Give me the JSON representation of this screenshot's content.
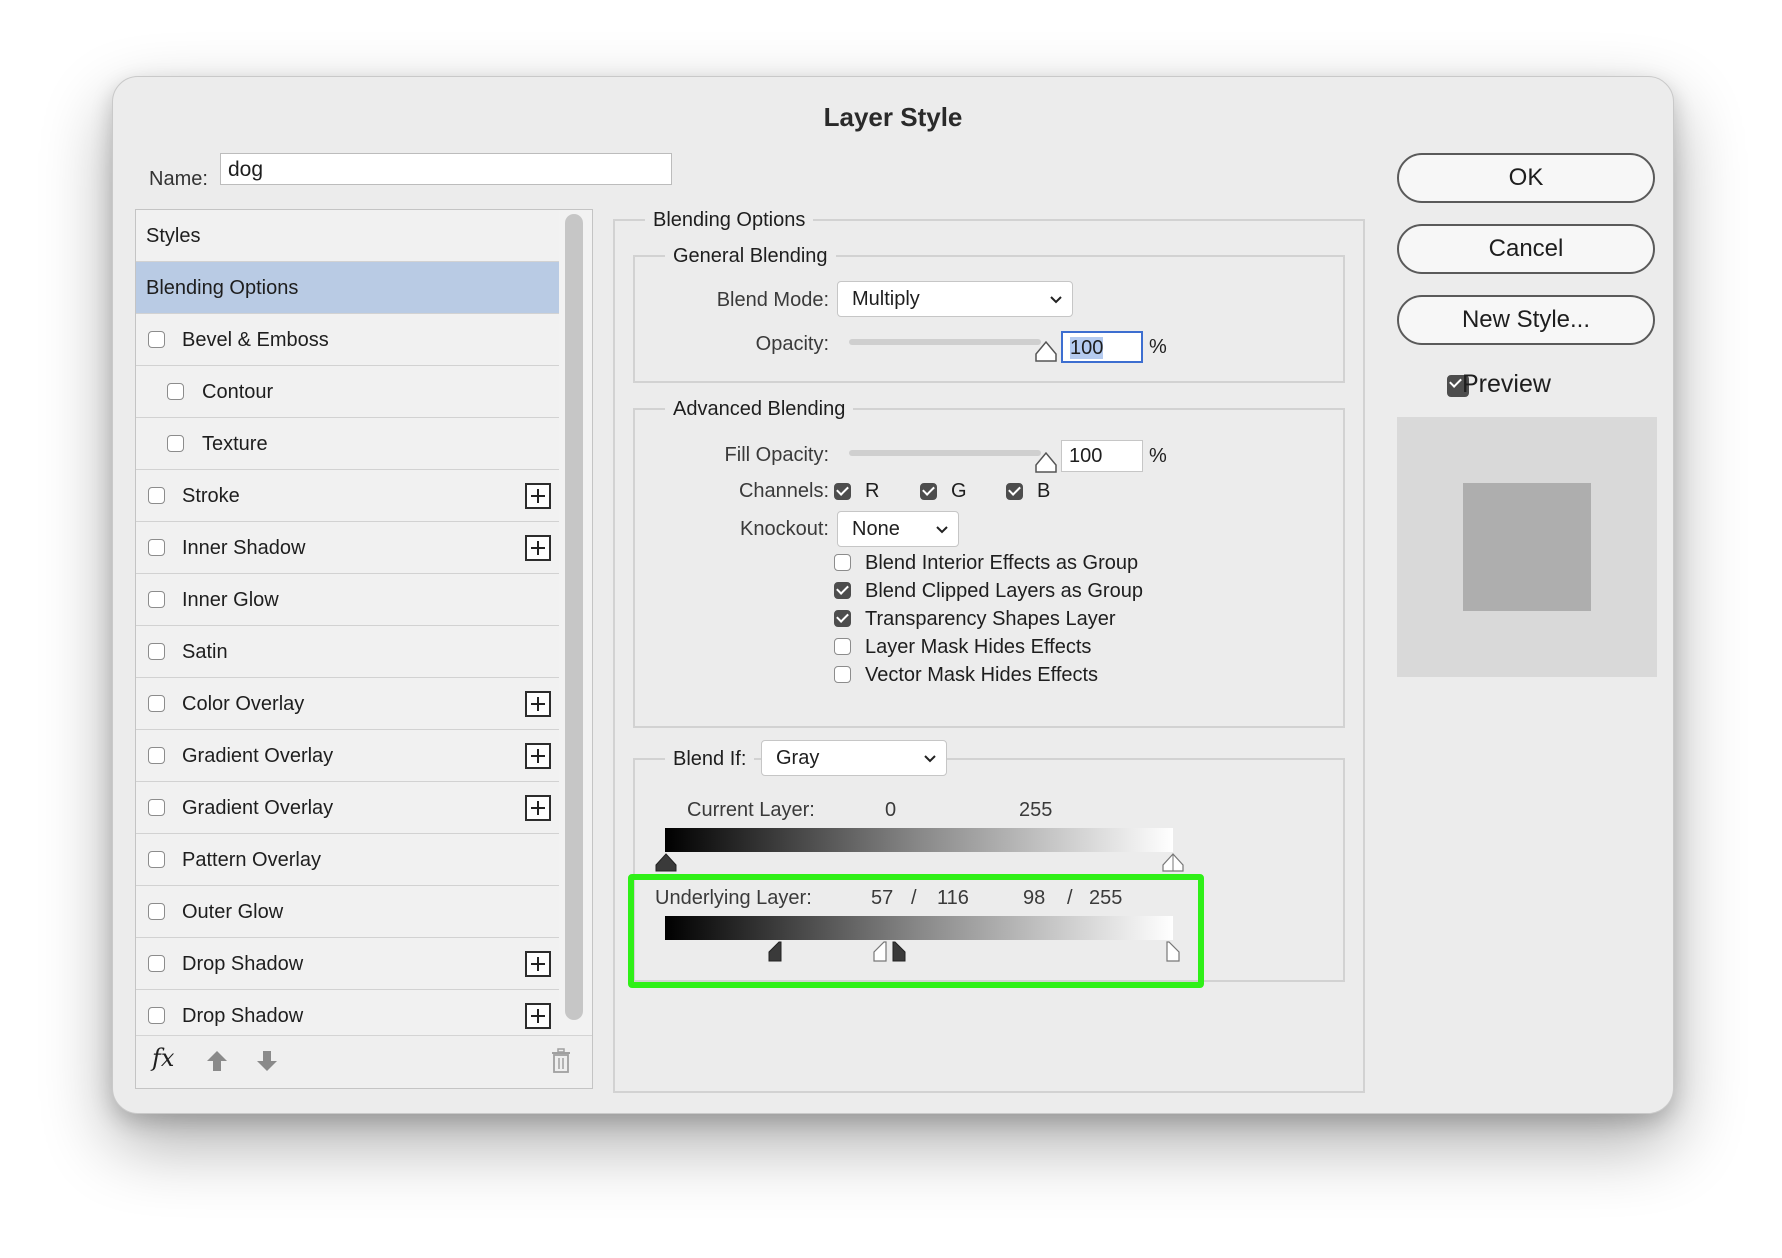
{
  "dialog": {
    "title": "Layer Style",
    "name_label": "Name:",
    "name_value": "dog"
  },
  "style_list": {
    "items": [
      {
        "label": "Styles",
        "type": "header"
      },
      {
        "label": "Blending Options",
        "type": "selected"
      },
      {
        "label": "Bevel & Emboss",
        "checked": false
      },
      {
        "label": "Contour",
        "checked": false,
        "indent": true
      },
      {
        "label": "Texture",
        "checked": false,
        "indent": true
      },
      {
        "label": "Stroke",
        "checked": false,
        "plus": true
      },
      {
        "label": "Inner Shadow",
        "checked": false,
        "plus": true
      },
      {
        "label": "Inner Glow",
        "checked": false
      },
      {
        "label": "Satin",
        "checked": false
      },
      {
        "label": "Color Overlay",
        "checked": false,
        "plus": true
      },
      {
        "label": "Gradient Overlay",
        "checked": false,
        "plus": true
      },
      {
        "label": "Gradient Overlay",
        "checked": false,
        "plus": true
      },
      {
        "label": "Pattern Overlay",
        "checked": false
      },
      {
        "label": "Outer Glow",
        "checked": false
      },
      {
        "label": "Drop Shadow",
        "checked": false,
        "plus": true
      },
      {
        "label": "Drop Shadow",
        "checked": false,
        "plus": true
      }
    ],
    "footer": {
      "fx": "fx"
    }
  },
  "blending": {
    "title": "Blending Options",
    "general": {
      "title": "General Blending",
      "blend_mode_label": "Blend Mode:",
      "blend_mode_value": "Multiply",
      "opacity_label": "Opacity:",
      "opacity_value": "100",
      "opacity_unit": "%"
    },
    "advanced": {
      "title": "Advanced Blending",
      "fill_opacity_label": "Fill Opacity:",
      "fill_opacity_value": "100",
      "fill_opacity_unit": "%",
      "channels_label": "Channels:",
      "channels": [
        {
          "label": "R",
          "checked": true
        },
        {
          "label": "G",
          "checked": true
        },
        {
          "label": "B",
          "checked": true
        }
      ],
      "knockout_label": "Knockout:",
      "knockout_value": "None",
      "options": [
        {
          "label": "Blend Interior Effects as Group",
          "checked": false
        },
        {
          "label": "Blend Clipped Layers as Group",
          "checked": true
        },
        {
          "label": "Transparency Shapes Layer",
          "checked": true
        },
        {
          "label": "Layer Mask Hides Effects",
          "checked": false
        },
        {
          "label": "Vector Mask Hides Effects",
          "checked": false
        }
      ]
    },
    "blend_if": {
      "label": "Blend If:",
      "value": "Gray",
      "current_layer": {
        "label": "Current Layer:",
        "black": "0",
        "white": "255"
      },
      "underlying_layer": {
        "label": "Underlying Layer:",
        "black_low": "57",
        "sep1": "/",
        "black_high": "116",
        "white_low": "98",
        "sep2": "/",
        "white_high": "255"
      }
    }
  },
  "right": {
    "ok": "OK",
    "cancel": "Cancel",
    "new_style": "New Style...",
    "preview_label": "Preview",
    "preview_checked": true
  },
  "colors": {
    "selected_row": "#b9cbe4",
    "highlight": "#2ff017",
    "preview_bg": "#d9d9d9",
    "preview_swatch": "#aeaeae"
  }
}
